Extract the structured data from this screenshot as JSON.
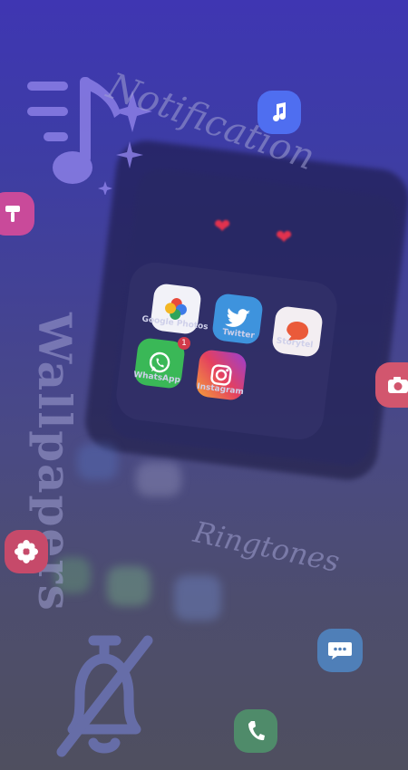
{
  "words": {
    "notification": "Notification",
    "wallpapers": "Wallpapers",
    "ringtones": "Ringtones"
  },
  "apps": [
    {
      "label": "Google Photos",
      "icon": "pinwheel-icon"
    },
    {
      "label": "Twitter",
      "icon": "bird-icon"
    },
    {
      "label": "Storytel",
      "icon": "speech-bubble-icon"
    },
    {
      "label": "WhatsApp",
      "icon": "whatsapp-icon",
      "badge": "1"
    },
    {
      "label": "Instagram",
      "icon": "camera-icon"
    }
  ],
  "colors": {
    "accent_blue": "#4f6ef0",
    "accent_red": "#d2566e",
    "accent_green": "#4f8b6a",
    "accent_teal": "#4f7fb8"
  }
}
